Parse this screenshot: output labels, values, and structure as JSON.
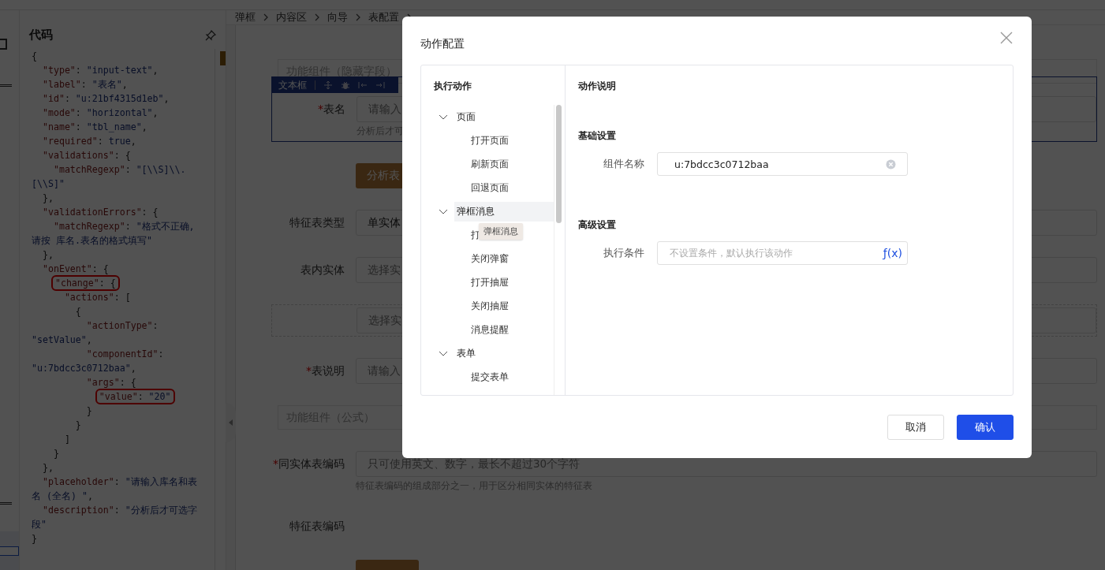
{
  "code_panel": {
    "title": "代码",
    "lines": [
      {
        "parts": [
          {
            "kind": "punc",
            "text": "{"
          }
        ]
      },
      {
        "parts": [
          {
            "kind": "key",
            "text": "  \"type\""
          },
          {
            "kind": "punc",
            "text": ": "
          },
          {
            "kind": "str",
            "text": "\"input-text\""
          },
          {
            "kind": "punc",
            "text": ","
          }
        ]
      },
      {
        "parts": [
          {
            "kind": "key",
            "text": "  \"label\""
          },
          {
            "kind": "punc",
            "text": ": "
          },
          {
            "kind": "str",
            "text": "\"表名\""
          },
          {
            "kind": "punc",
            "text": ","
          }
        ]
      },
      {
        "parts": [
          {
            "kind": "key",
            "text": "  \"id\""
          },
          {
            "kind": "punc",
            "text": ": "
          },
          {
            "kind": "str",
            "text": "\"u:21bf4315d1eb\""
          },
          {
            "kind": "punc",
            "text": ","
          }
        ]
      },
      {
        "parts": [
          {
            "kind": "key",
            "text": "  \"mode\""
          },
          {
            "kind": "punc",
            "text": ": "
          },
          {
            "kind": "str",
            "text": "\"horizontal\""
          },
          {
            "kind": "punc",
            "text": ","
          }
        ]
      },
      {
        "parts": [
          {
            "kind": "key",
            "text": "  \"name\""
          },
          {
            "kind": "punc",
            "text": ": "
          },
          {
            "kind": "str",
            "text": "\"tbl_name\""
          },
          {
            "kind": "punc",
            "text": ","
          }
        ]
      },
      {
        "parts": [
          {
            "kind": "key",
            "text": "  \"required\""
          },
          {
            "kind": "punc",
            "text": ": "
          },
          {
            "kind": "lit",
            "text": "true"
          },
          {
            "kind": "punc",
            "text": ","
          }
        ]
      },
      {
        "parts": [
          {
            "kind": "key",
            "text": "  \"validations\""
          },
          {
            "kind": "punc",
            "text": ": {"
          }
        ]
      },
      {
        "parts": [
          {
            "kind": "key",
            "text": "    \"matchRegexp\""
          },
          {
            "kind": "punc",
            "text": ": "
          },
          {
            "kind": "str",
            "text": "\"[\\\\S]\\\\."
          }
        ]
      },
      {
        "parts": [
          {
            "kind": "str",
            "text": "[\\\\S]\""
          }
        ]
      },
      {
        "parts": [
          {
            "kind": "punc",
            "text": "  },"
          }
        ]
      },
      {
        "parts": [
          {
            "kind": "key",
            "text": "  \"validationErrors\""
          },
          {
            "kind": "punc",
            "text": ": {"
          }
        ]
      },
      {
        "parts": [
          {
            "kind": "key",
            "text": "    \"matchRegexp\""
          },
          {
            "kind": "punc",
            "text": ": "
          },
          {
            "kind": "str",
            "text": "\"格式不正确,"
          }
        ]
      },
      {
        "parts": [
          {
            "kind": "str",
            "text": "请按 库名.表名的格式填写\""
          }
        ]
      },
      {
        "parts": [
          {
            "kind": "punc",
            "text": "  },"
          }
        ]
      },
      {
        "parts": [
          {
            "kind": "key",
            "text": "  \"onEvent\""
          },
          {
            "kind": "punc",
            "text": ": {"
          }
        ]
      },
      {
        "highlighted": true,
        "parts": [
          {
            "kind": "key",
            "text": "    \"change\""
          },
          {
            "kind": "punc",
            "text": ": {"
          }
        ]
      },
      {
        "parts": [
          {
            "kind": "key",
            "text": "      \"actions\""
          },
          {
            "kind": "punc",
            "text": ": ["
          }
        ]
      },
      {
        "parts": [
          {
            "kind": "punc",
            "text": "        {"
          }
        ]
      },
      {
        "parts": [
          {
            "kind": "key",
            "text": "          \"actionType\""
          },
          {
            "kind": "punc",
            "text": ":"
          }
        ]
      },
      {
        "parts": [
          {
            "kind": "str",
            "text": "\"setValue\""
          },
          {
            "kind": "punc",
            "text": ","
          }
        ]
      },
      {
        "parts": [
          {
            "kind": "key",
            "text": "          \"componentId\""
          },
          {
            "kind": "punc",
            "text": ":"
          }
        ]
      },
      {
        "parts": [
          {
            "kind": "str",
            "text": "\"u:7bdcc3c0712baa\""
          },
          {
            "kind": "punc",
            "text": ","
          }
        ]
      },
      {
        "parts": [
          {
            "kind": "key",
            "text": "          \"args\""
          },
          {
            "kind": "punc",
            "text": ": {"
          }
        ]
      },
      {
        "highlighted": true,
        "parts": [
          {
            "kind": "key",
            "text": "            \"value\""
          },
          {
            "kind": "punc",
            "text": ": "
          },
          {
            "kind": "str",
            "text": "\"20\""
          }
        ]
      },
      {
        "parts": [
          {
            "kind": "punc",
            "text": "          }"
          }
        ]
      },
      {
        "parts": [
          {
            "kind": "punc",
            "text": "        }"
          }
        ]
      },
      {
        "parts": [
          {
            "kind": "punc",
            "text": "      ]"
          }
        ]
      },
      {
        "parts": [
          {
            "kind": "punc",
            "text": "    }"
          }
        ]
      },
      {
        "parts": [
          {
            "kind": "punc",
            "text": "  },"
          }
        ]
      },
      {
        "parts": [
          {
            "kind": "key",
            "text": "  \"placeholder\""
          },
          {
            "kind": "punc",
            "text": ": "
          },
          {
            "kind": "str",
            "text": "\"请输入库名和表"
          }
        ]
      },
      {
        "parts": [
          {
            "kind": "str",
            "text": "名 (全名) \""
          },
          {
            "kind": "punc",
            "text": ","
          }
        ]
      },
      {
        "parts": [
          {
            "kind": "key",
            "text": "  \"description\""
          },
          {
            "kind": "punc",
            "text": ": "
          },
          {
            "kind": "str",
            "text": "\"分析后才可选字"
          }
        ]
      },
      {
        "parts": [
          {
            "kind": "str",
            "text": "段\""
          }
        ]
      },
      {
        "parts": [
          {
            "kind": "punc",
            "text": "}"
          }
        ]
      }
    ]
  },
  "breadcrumb": [
    "弹框",
    "内容区",
    "向导",
    "表配置"
  ],
  "form": {
    "toolbar_label": "文本框",
    "required_mark": "*",
    "items": [
      {
        "kind": "hidden-box",
        "text": "功能组件（隐藏字段）"
      },
      {
        "kind": "field",
        "label": "表名",
        "required": true,
        "selected": true,
        "placeholder": "请输入",
        "help": "分析后才可"
      },
      {
        "kind": "button",
        "text": "分析表"
      },
      {
        "kind": "field",
        "label": "特征表类型",
        "required": false,
        "selected": false,
        "value": "单实体"
      },
      {
        "kind": "field",
        "label": "表内实体",
        "required": false,
        "selected": false,
        "placeholder": "选择实"
      },
      {
        "kind": "dashed-field",
        "placeholder": "选择实"
      },
      {
        "kind": "field",
        "label": "表说明",
        "required": true,
        "selected": false,
        "placeholder": "请输入"
      },
      {
        "kind": "hidden-box",
        "text": "功能组件（公式）"
      },
      {
        "kind": "field",
        "label": "同实体表编码",
        "required": true,
        "selected": false,
        "placeholder": "只可使用英文、数字，最长不超过30个字符",
        "help": "特征表编码的组成部分之一，用于区分相同实体的特征表"
      },
      {
        "kind": "label-only",
        "label": "特征表编码"
      },
      {
        "kind": "cut-button"
      }
    ]
  },
  "dialog": {
    "title": "动作配置",
    "left_title": "执行动作",
    "tree": [
      {
        "label": "页面",
        "expanded": true,
        "selected": false,
        "children": [
          {
            "label": "打开页面",
            "selected": false
          },
          {
            "label": "刷新页面",
            "selected": false
          },
          {
            "label": "回退页面",
            "selected": false
          }
        ]
      },
      {
        "label": "弹框消息",
        "expanded": true,
        "selected": true,
        "children": [
          {
            "label": "打",
            "selected": false
          },
          {
            "label": "关闭弹窗",
            "selected": false
          },
          {
            "label": "打开抽屉",
            "selected": false
          },
          {
            "label": "关闭抽屉",
            "selected": false
          },
          {
            "label": "消息提醒",
            "selected": false
          }
        ]
      },
      {
        "label": "表单",
        "expanded": true,
        "selected": false,
        "children": [
          {
            "label": "提交表单",
            "selected": false
          }
        ]
      }
    ],
    "tooltip": "弹框消息",
    "right_title": "动作说明",
    "sections": [
      {
        "title": "基础设置",
        "label": "组件名称",
        "value": "u:7bdcc3c0712baa",
        "kind": "clearable"
      },
      {
        "title": "高级设置",
        "label": "执行条件",
        "placeholder": "不设置条件，默认执行该动作",
        "kind": "formula",
        "fx": "ƒ(x)"
      }
    ],
    "buttons": [
      {
        "label": "取消",
        "kind": "default"
      },
      {
        "label": "确认",
        "kind": "primary"
      }
    ]
  }
}
